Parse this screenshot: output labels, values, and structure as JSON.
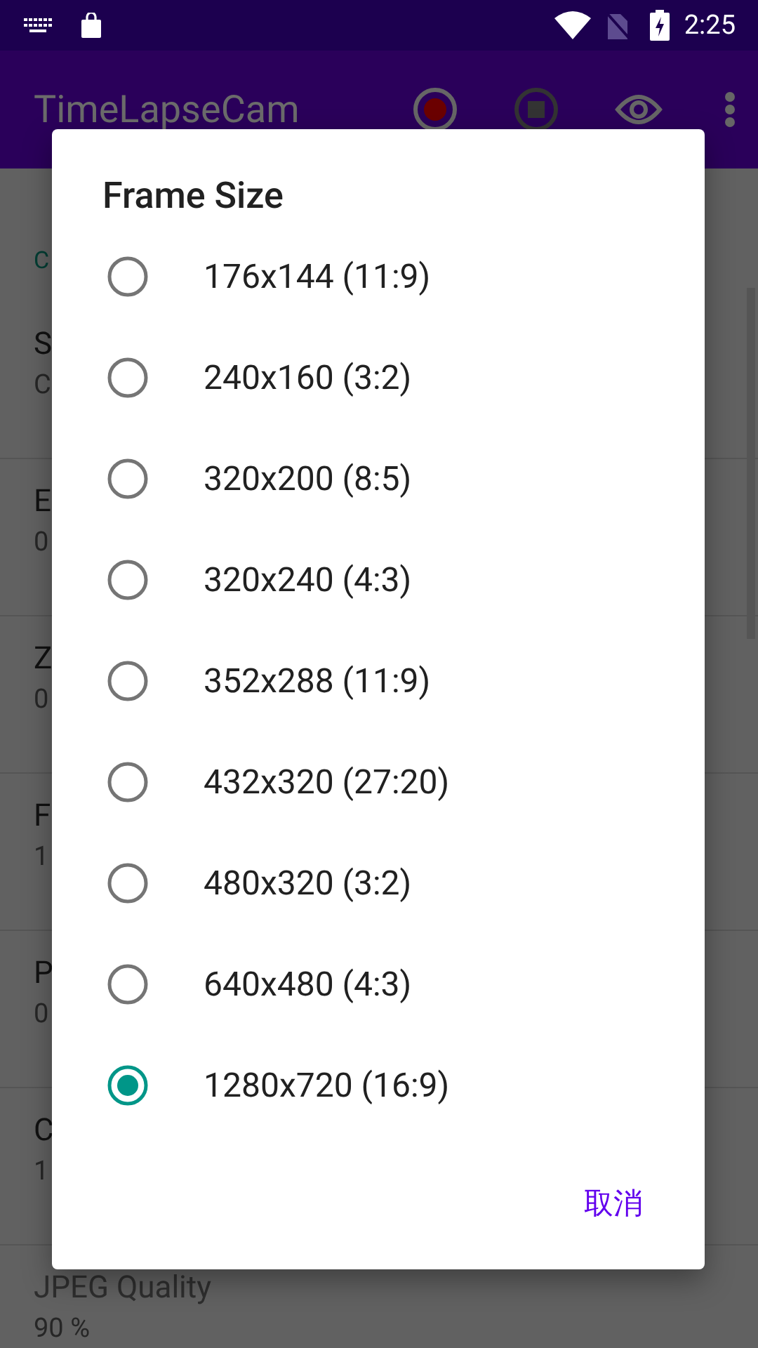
{
  "status_bar": {
    "time": "2:25"
  },
  "app_bar": {
    "title": "TimeLapseCam"
  },
  "settings": {
    "category": "C",
    "items": [
      {
        "title": "S",
        "summary": "C"
      },
      {
        "title": "E",
        "summary": "0"
      },
      {
        "title": "Z",
        "summary": "0"
      },
      {
        "title": "F",
        "summary": "1"
      },
      {
        "title": "P",
        "summary": "0"
      },
      {
        "title": "C",
        "summary": "1"
      },
      {
        "title": "JPEG Quality",
        "summary": "90 %"
      }
    ]
  },
  "dialog": {
    "title": "Frame Size",
    "options": [
      {
        "label": "176x144 (11:9)",
        "selected": false
      },
      {
        "label": "240x160 (3:2)",
        "selected": false
      },
      {
        "label": "320x200 (8:5)",
        "selected": false
      },
      {
        "label": "320x240 (4:3)",
        "selected": false
      },
      {
        "label": "352x288 (11:9)",
        "selected": false
      },
      {
        "label": "432x320 (27:20)",
        "selected": false
      },
      {
        "label": "480x320 (3:2)",
        "selected": false
      },
      {
        "label": "640x480 (4:3)",
        "selected": false
      },
      {
        "label": "1280x720 (16:9)",
        "selected": true
      }
    ],
    "buttons": [
      "取消"
    ]
  }
}
